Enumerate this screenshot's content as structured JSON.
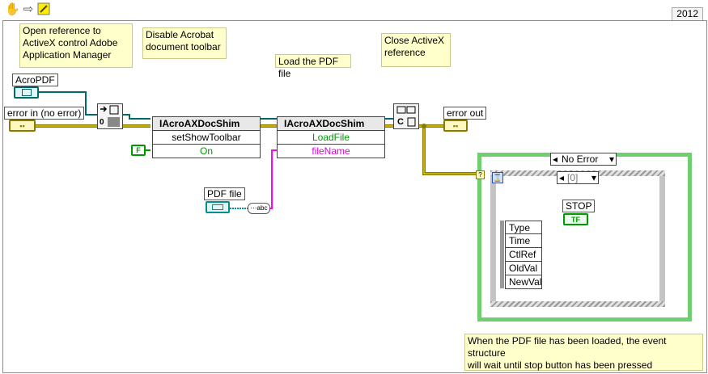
{
  "toolbar": {
    "run_icon": "hand-icon",
    "step_icon": "arrow-icon",
    "probe_icon": "bulb-icon",
    "version": "2012"
  },
  "comments": {
    "open_ref": "Open reference to\nActiveX control Adobe\nApplication Manager",
    "disable_toolbar": "Disable Acrobat\ndocument toolbar",
    "load_pdf": "Load the PDF file",
    "close_ref": "Close ActiveX\nreference",
    "event_note": "When the PDF file has been loaded, the event structure\nwill wait until stop button has been pressed"
  },
  "terminals": {
    "acropdf": "AcroPDF",
    "error_in": "error in (no error)",
    "error_out": "error out",
    "pdf_file": "PDF file",
    "stop": "STOP",
    "false_const": "F",
    "tf_indicator": "TF"
  },
  "nodes": {
    "invoke1_title": "IAcroAXDocShim",
    "invoke1_method": "setShowToolbar",
    "invoke1_param": "On",
    "invoke2_title": "IAcroAXDocShim",
    "invoke2_method": "LoadFile",
    "invoke2_param": "fileName",
    "open_node_text": "0",
    "close_node_text": "C"
  },
  "case_structure": {
    "selector": "No Error",
    "event_selector": "[0]"
  },
  "event_data": [
    "Type",
    "Time",
    "CtlRef",
    "OldVal",
    "NewVal"
  ],
  "colors": {
    "error_wire": "#c8b400",
    "refnum_wire": "#006a6a",
    "path_wire": "#009090",
    "string_wire": "#ff00ff",
    "boolean": "#009900",
    "case_frame": "#6fce6f",
    "event_frame": "#b0b0b0",
    "comment_bg": "#ffffcc"
  }
}
